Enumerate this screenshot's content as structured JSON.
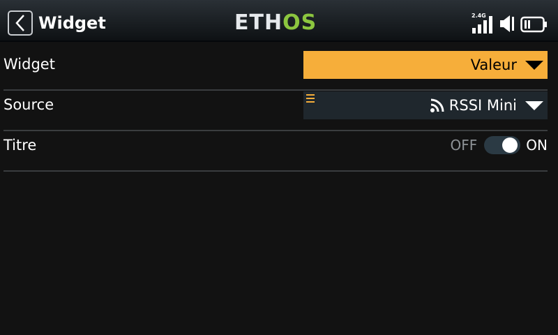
{
  "header": {
    "title": "Widget",
    "logo_main": "ETH",
    "logo_accent": "OS",
    "band": "2.4G",
    "icons": [
      "back-arrow",
      "signal-bars",
      "speaker",
      "battery"
    ]
  },
  "rows": [
    {
      "label": "Widget",
      "value": "Valeur",
      "control": "dropdown"
    },
    {
      "label": "Source",
      "value": "RSSI Mini",
      "control": "dropdown",
      "icon": "rssi-signal"
    },
    {
      "label": "Titre",
      "off_label": "OFF",
      "on_label": "ON",
      "control": "toggle",
      "state": "on"
    }
  ],
  "colors": {
    "accent": "#f6ae3a",
    "logo_green": "#8cc63f",
    "background": "#121212",
    "field_dark": "#1f272d"
  }
}
